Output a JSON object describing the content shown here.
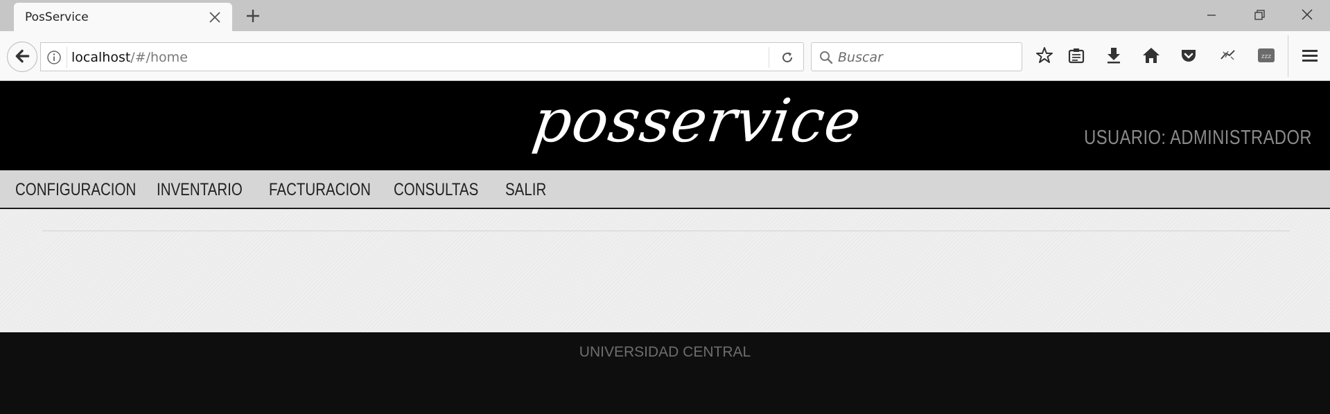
{
  "browser": {
    "tab_title": "PosService",
    "url_host": "localhost",
    "url_path": "/#/home",
    "search_placeholder": "Buscar"
  },
  "site": {
    "brand": "posservice",
    "user_label": "USUARIO: ADMINISTRADOR",
    "menu": [
      {
        "label": "CONFIGURACION"
      },
      {
        "label": "INVENTARIO"
      },
      {
        "label": "FACTURACION"
      },
      {
        "label": "CONSULTAS"
      },
      {
        "label": "SALIR"
      }
    ],
    "footer": "UNIVERSIDAD CENTRAL"
  },
  "colors": {
    "header_bg": "#000000",
    "menu_bg": "#d6d6d6",
    "content_bg": "#f0f0f0",
    "footer_bg": "#0e0e0e"
  },
  "toolbar_icons": [
    "bookmark-star-icon",
    "reading-list-icon",
    "download-icon",
    "home-icon",
    "pocket-icon",
    "bug-extension-icon",
    "sleep-extension-icon",
    "hamburger-menu-icon"
  ]
}
